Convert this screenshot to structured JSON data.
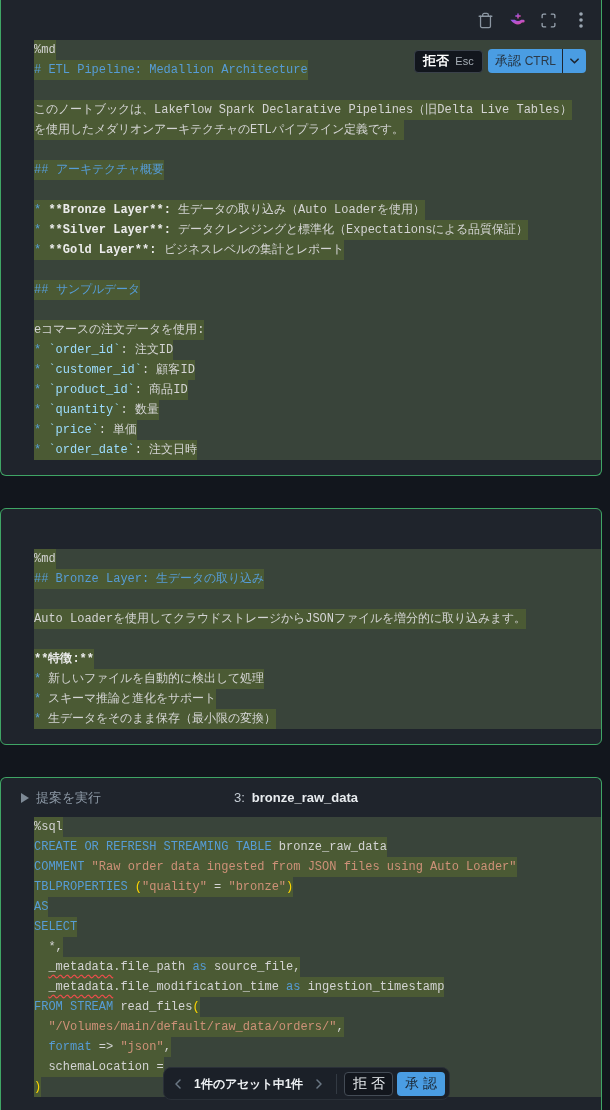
{
  "cells": [
    {
      "toolbar": true,
      "actions": {
        "reject": {
          "label": "拒否",
          "shortcut": "Esc"
        },
        "accept": {
          "label": "承認",
          "shortcut": "CTRL"
        }
      },
      "lines": [
        {
          "kind": "text",
          "indented": false,
          "tokens": [
            {
              "kind": "plain",
              "text": "%md"
            }
          ]
        },
        {
          "kind": "text",
          "indented": false,
          "tokens": [
            {
              "kind": "markup",
              "text": "# ETL Pipeline: Medallion Architecture"
            }
          ]
        },
        {
          "kind": "blank"
        },
        {
          "kind": "text",
          "indented": false,
          "tokens": [
            {
              "kind": "plain",
              "text": "このノートブックは、Lakeflow Spark Declarative Pipelines（旧Delta Live Tables）"
            }
          ]
        },
        {
          "kind": "text",
          "indented": false,
          "tokens": [
            {
              "kind": "plain",
              "text": "を使用したメダリオンアーキテクチャのETLパイプライン定義です。"
            }
          ]
        },
        {
          "kind": "blank"
        },
        {
          "kind": "text",
          "indented": false,
          "tokens": [
            {
              "kind": "markup",
              "text": "## アーキテクチャ概要"
            }
          ]
        },
        {
          "kind": "blank"
        },
        {
          "kind": "text",
          "indented": false,
          "tokens": [
            {
              "kind": "markup",
              "text": "* "
            },
            {
              "kind": "strong",
              "text": "**Bronze Layer**:"
            },
            {
              "kind": "plain",
              "text": " 生データの取り込み（Auto Loaderを使用）"
            }
          ]
        },
        {
          "kind": "text",
          "indented": false,
          "tokens": [
            {
              "kind": "markup",
              "text": "* "
            },
            {
              "kind": "strong",
              "text": "**Silver Layer**:"
            },
            {
              "kind": "plain",
              "text": " データクレンジングと標準化（Expectationsによる品質保証）"
            }
          ]
        },
        {
          "kind": "text",
          "indented": false,
          "tokens": [
            {
              "kind": "markup",
              "text": "* "
            },
            {
              "kind": "strong",
              "text": "**Gold Layer**:"
            },
            {
              "kind": "plain",
              "text": " ビジネスレベルの集計とレポート"
            }
          ]
        },
        {
          "kind": "blank"
        },
        {
          "kind": "text",
          "indented": false,
          "tokens": [
            {
              "kind": "markup",
              "text": "## サンプルデータ"
            }
          ]
        },
        {
          "kind": "blank"
        },
        {
          "kind": "text",
          "indented": false,
          "tokens": [
            {
              "kind": "plain",
              "text": "eコマースの注文データを使用:"
            }
          ]
        },
        {
          "kind": "text",
          "indented": false,
          "tokens": [
            {
              "kind": "markup",
              "text": "* "
            },
            {
              "kind": "code",
              "text": "`order_id`"
            },
            {
              "kind": "plain",
              "text": ": 注文ID"
            }
          ]
        },
        {
          "kind": "text",
          "indented": false,
          "tokens": [
            {
              "kind": "markup",
              "text": "* "
            },
            {
              "kind": "code",
              "text": "`customer_id`"
            },
            {
              "kind": "plain",
              "text": ": 顧客ID"
            }
          ]
        },
        {
          "kind": "text",
          "indented": false,
          "tokens": [
            {
              "kind": "markup",
              "text": "* "
            },
            {
              "kind": "code",
              "text": "`product_id`"
            },
            {
              "kind": "plain",
              "text": ": 商品ID"
            }
          ]
        },
        {
          "kind": "text",
          "indented": false,
          "tokens": [
            {
              "kind": "markup",
              "text": "* "
            },
            {
              "kind": "code",
              "text": "`quantity`"
            },
            {
              "kind": "plain",
              "text": ": 数量"
            }
          ]
        },
        {
          "kind": "text",
          "indented": false,
          "tokens": [
            {
              "kind": "markup",
              "text": "* "
            },
            {
              "kind": "code",
              "text": "`price`"
            },
            {
              "kind": "plain",
              "text": ": 単価"
            }
          ]
        },
        {
          "kind": "text",
          "indented": false,
          "tokens": [
            {
              "kind": "markup",
              "text": "* "
            },
            {
              "kind": "code",
              "text": "`order_date`"
            },
            {
              "kind": "plain",
              "text": ": 注文日時"
            }
          ]
        }
      ]
    },
    {
      "toolbar": false,
      "lines": [
        {
          "kind": "text",
          "indented": false,
          "tokens": [
            {
              "kind": "plain",
              "text": "%md"
            }
          ]
        },
        {
          "kind": "text",
          "indented": false,
          "tokens": [
            {
              "kind": "markup",
              "text": "## Bronze Layer: 生データの取り込み"
            }
          ]
        },
        {
          "kind": "blank"
        },
        {
          "kind": "text",
          "indented": false,
          "tokens": [
            {
              "kind": "plain",
              "text": "Auto Loaderを使用してクラウドストレージからJSONファイルを増分的に取り込みます。"
            }
          ]
        },
        {
          "kind": "blank"
        },
        {
          "kind": "text",
          "indented": false,
          "tokens": [
            {
              "kind": "strong",
              "text": "**特徴:**"
            }
          ]
        },
        {
          "kind": "text",
          "indented": false,
          "tokens": [
            {
              "kind": "markup",
              "text": "* "
            },
            {
              "kind": "plain",
              "text": "新しいファイルを自動的に検出して処理"
            }
          ]
        },
        {
          "kind": "text",
          "indented": false,
          "tokens": [
            {
              "kind": "markup",
              "text": "* "
            },
            {
              "kind": "plain",
              "text": "スキーマ推論と進化をサポート"
            }
          ]
        },
        {
          "kind": "text",
          "indented": false,
          "tokens": [
            {
              "kind": "markup",
              "text": "* "
            },
            {
              "kind": "plain",
              "text": "生データをそのまま保存（最小限の変換）"
            }
          ]
        }
      ]
    },
    {
      "toolbar": false,
      "header": {
        "run_label": "提案を実行",
        "index": "3:",
        "name": "bronze_raw_data"
      },
      "lines": [
        {
          "kind": "text",
          "indented": false,
          "tokens": [
            {
              "kind": "plain",
              "text": "%sql"
            }
          ]
        },
        {
          "kind": "text",
          "indented": false,
          "tokens": [
            {
              "kind": "keyword",
              "text": "CREATE OR REFRESH STREAMING TABLE"
            },
            {
              "kind": "plain",
              "text": " bronze_raw_data"
            }
          ]
        },
        {
          "kind": "text",
          "indented": false,
          "tokens": [
            {
              "kind": "keyword",
              "text": "COMMENT"
            },
            {
              "kind": "string",
              "text": " \"Raw order data ingested from JSON files using Auto Loader\""
            }
          ]
        },
        {
          "kind": "text",
          "indented": false,
          "tokens": [
            {
              "kind": "keyword",
              "text": "TBLPROPERTIES"
            },
            {
              "kind": "paren",
              "text": " ("
            },
            {
              "kind": "string",
              "text": "\"quality\""
            },
            {
              "kind": "plain",
              "text": " = "
            },
            {
              "kind": "string",
              "text": "\"bronze\""
            },
            {
              "kind": "paren",
              "text": ")"
            }
          ]
        },
        {
          "kind": "text",
          "indented": false,
          "tokens": [
            {
              "kind": "keyword",
              "text": "AS"
            }
          ]
        },
        {
          "kind": "text",
          "indented": false,
          "tokens": [
            {
              "kind": "keyword",
              "text": "SELECT"
            }
          ]
        },
        {
          "kind": "text",
          "indented": true,
          "tokens": [
            {
              "kind": "plain",
              "text": "*,"
            }
          ]
        },
        {
          "kind": "text",
          "indented": true,
          "tokens": [
            {
              "kind": "flagged",
              "text": "_metadata"
            },
            {
              "kind": "plain",
              "text": ".file_path "
            },
            {
              "kind": "keyword",
              "text": "as"
            },
            {
              "kind": "plain",
              "text": " source_file,"
            }
          ]
        },
        {
          "kind": "text",
          "indented": true,
          "tokens": [
            {
              "kind": "flagged",
              "text": "_metadata"
            },
            {
              "kind": "plain",
              "text": ".file_modification_time "
            },
            {
              "kind": "keyword",
              "text": "as"
            },
            {
              "kind": "plain",
              "text": " ingestion_timestamp"
            }
          ]
        },
        {
          "kind": "text",
          "indented": false,
          "tokens": [
            {
              "kind": "keyword",
              "text": "FROM STREAM"
            },
            {
              "kind": "plain",
              "text": " read_files"
            },
            {
              "kind": "paren",
              "text": "("
            }
          ]
        },
        {
          "kind": "text",
          "indented": true,
          "tokens": [
            {
              "kind": "string",
              "text": "\"/Volumes/main/default/raw_data/orders/\""
            },
            {
              "kind": "plain",
              "text": ","
            }
          ]
        },
        {
          "kind": "text",
          "indented": true,
          "tokens": [
            {
              "kind": "keyword",
              "text": "format"
            },
            {
              "kind": "plain",
              "text": " => "
            },
            {
              "kind": "string",
              "text": "\"json\""
            },
            {
              "kind": "plain",
              "text": ","
            }
          ]
        },
        {
          "kind": "text",
          "indented": true,
          "tokens": [
            {
              "kind": "plain",
              "text": "schemaLocation ="
            }
          ]
        },
        {
          "kind": "text",
          "indented": false,
          "tokens": [
            {
              "kind": "paren",
              "text": ")"
            }
          ]
        }
      ]
    }
  ],
  "review_bar": {
    "counter": "1件のアセット中1件",
    "reject": "拒 否",
    "accept": "承 認"
  }
}
